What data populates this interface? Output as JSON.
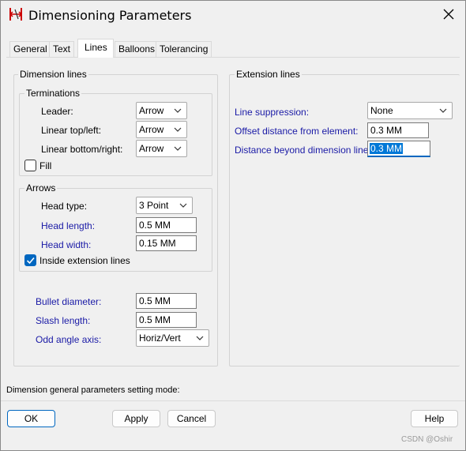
{
  "window": {
    "title": "Dimensioning Parameters",
    "icon": "red-dimension-app-icon",
    "close_icon": "close-icon"
  },
  "tabs": [
    {
      "label": "General",
      "active": false
    },
    {
      "label": "Text",
      "active": false
    },
    {
      "label": "Lines",
      "active": true
    },
    {
      "label": "Balloons",
      "active": false
    },
    {
      "label": "Tolerancing",
      "active": false
    }
  ],
  "dimension_lines": {
    "title": "Dimension lines",
    "terminations": {
      "title": "Terminations",
      "leader": {
        "label": "Leader:",
        "value": "Arrow"
      },
      "linear_top_left": {
        "label": "Linear top/left:",
        "value": "Arrow"
      },
      "linear_bottom_right": {
        "label": "Linear bottom/right:",
        "value": "Arrow"
      },
      "fill": {
        "label": "Fill",
        "checked": false
      }
    },
    "arrows": {
      "title": "Arrows",
      "head_type": {
        "label": "Head type:",
        "value": "3 Point"
      },
      "head_length": {
        "label": "Head length:",
        "value": "0.5 MM"
      },
      "head_width": {
        "label": "Head width:",
        "value": "0.15 MM"
      },
      "inside_extension_lines": {
        "label": "Inside extension lines",
        "checked": true
      }
    },
    "bullet_diameter": {
      "label": "Bullet diameter:",
      "value": "0.5 MM"
    },
    "slash_length": {
      "label": "Slash length:",
      "value": "0.5 MM"
    },
    "odd_angle_axis": {
      "label": "Odd angle axis:",
      "value": "Horiz/Vert"
    }
  },
  "extension_lines": {
    "title": "Extension lines",
    "line_suppression": {
      "label": "Line suppression:",
      "value": "None"
    },
    "offset_distance": {
      "label": "Offset distance from element:",
      "value": "0.3 MM"
    },
    "distance_beyond": {
      "label": "Distance beyond dimension line:",
      "value": "0.3 MM"
    }
  },
  "status_text": "Dimension general parameters setting mode:",
  "buttons": {
    "ok": "OK",
    "apply": "Apply",
    "cancel": "Cancel",
    "help": "Help"
  },
  "watermark": "CSDN @Oshir",
  "colors": {
    "accent": "#0067c0",
    "blue_label": "#1a1aa6",
    "selection": "#0078d7"
  }
}
